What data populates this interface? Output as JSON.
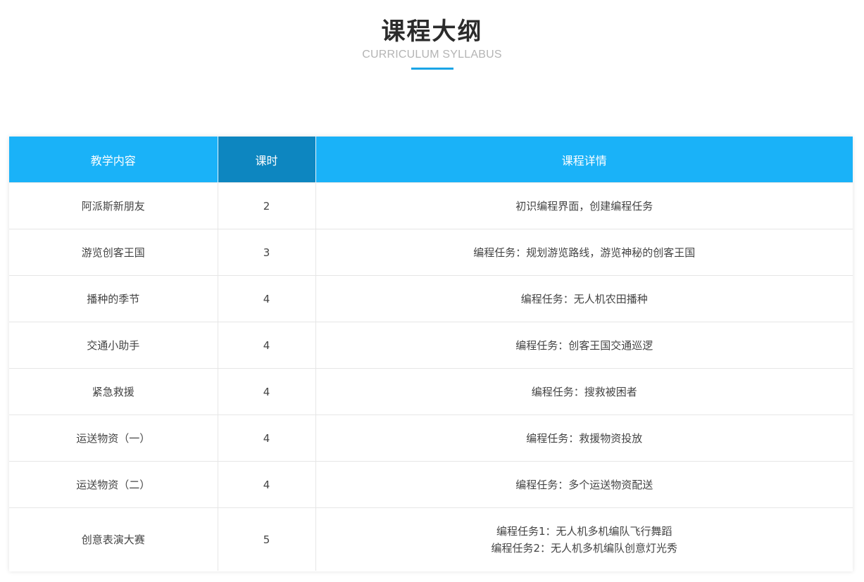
{
  "header": {
    "title": "课程大纲",
    "subtitle": "CURRICULUM SYLLABUS"
  },
  "colors": {
    "header_bg": "#1ab2f8",
    "header_active_bg": "#0d86c0",
    "accent_underline": "#1aa4e6"
  },
  "table": {
    "columns": [
      "教学内容",
      "课时",
      "课程详情"
    ],
    "rows": [
      {
        "content": "阿派斯新朋友",
        "hours": "2",
        "details": [
          "初识编程界面，创建编程任务"
        ]
      },
      {
        "content": "游览创客王国",
        "hours": "3",
        "details": [
          "编程任务：规划游览路线，游览神秘的创客王国"
        ]
      },
      {
        "content": "播种的季节",
        "hours": "4",
        "details": [
          "编程任务：无人机农田播种"
        ]
      },
      {
        "content": "交通小助手",
        "hours": "4",
        "details": [
          "编程任务：创客王国交通巡逻"
        ]
      },
      {
        "content": "紧急救援",
        "hours": "4",
        "details": [
          "编程任务：搜救被困者"
        ]
      },
      {
        "content": "运送物资（一）",
        "hours": "4",
        "details": [
          "编程任务：救援物资投放"
        ]
      },
      {
        "content": "运送物资（二）",
        "hours": "4",
        "details": [
          "编程任务：多个运送物资配送"
        ]
      },
      {
        "content": "创意表演大赛",
        "hours": "5",
        "details": [
          "编程任务1：无人机多机编队飞行舞蹈",
          "编程任务2：无人机多机编队创意灯光秀"
        ]
      }
    ]
  }
}
